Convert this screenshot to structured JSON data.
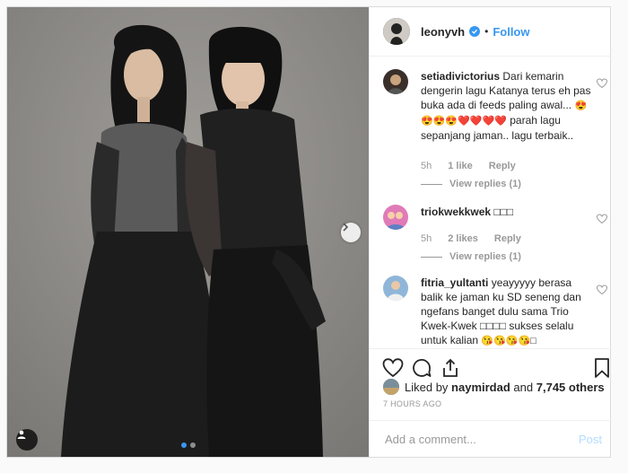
{
  "post": {
    "username": "leonyvh",
    "separator": "•",
    "follow_label": "Follow",
    "carousel_index": 1,
    "carousel_count": 2
  },
  "comments": [
    {
      "user": "setiadivictorius",
      "text": "Dari kemarin dengerin lagu Katanya terus eh pas buka ada di feeds paling awal...",
      "emoji_line": "😍😍😍😍❤️❤️❤️❤️",
      "text2": "parah lagu sepanjang jaman.. lagu terbaik..",
      "time": "5h",
      "likes": "1 like",
      "reply": "Reply",
      "view_replies": "View replies (1)"
    },
    {
      "user": "triokwekkwek",
      "text": "□□□",
      "time": "5h",
      "likes": "2 likes",
      "reply": "Reply",
      "view_replies": "View replies (1)"
    },
    {
      "user": "fitria_yultanti",
      "text": "yeayyyyy berasa balik ke jaman ku SD seneng dan ngefans banget dulu sama Trio Kwek-Kwek □□□□ sukses selalu untuk kalian",
      "emoji_line": "😘😘😘😘□"
    }
  ],
  "likes": {
    "prefix": "Liked by",
    "user": "naymirdad",
    "conj": "and",
    "count": "7,745 others"
  },
  "timestamp": "7 HOURS AGO",
  "add_comment": {
    "placeholder": "Add a comment...",
    "post_label": "Post"
  },
  "colors": {
    "accent": "#3897f0",
    "muted": "#999999",
    "photo_bg": "#8c8a87"
  },
  "icons": [
    "chevron-right-icon",
    "user-tag-icon",
    "verified-icon",
    "heart-icon",
    "comment-icon",
    "share-icon",
    "bookmark-icon"
  ]
}
